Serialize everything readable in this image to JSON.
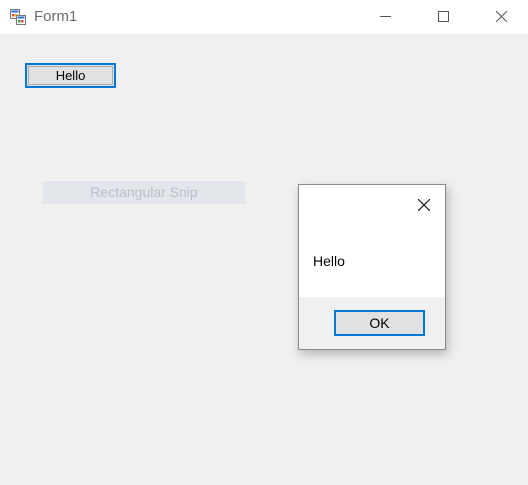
{
  "window": {
    "title": "Form1",
    "icon": "winforms-app-icon",
    "controls": {
      "minimize": "minimize-icon",
      "maximize": "maximize-icon",
      "close": "close-icon"
    }
  },
  "form": {
    "button_label": "Hello",
    "snip_label": "Rectangular Snip"
  },
  "message_box": {
    "text": "Hello",
    "ok_label": "OK",
    "close": "close-icon"
  },
  "colors": {
    "focus_border": "#0078d7",
    "form_background": "#f0f0f0",
    "button_face": "#e1e1e1"
  }
}
